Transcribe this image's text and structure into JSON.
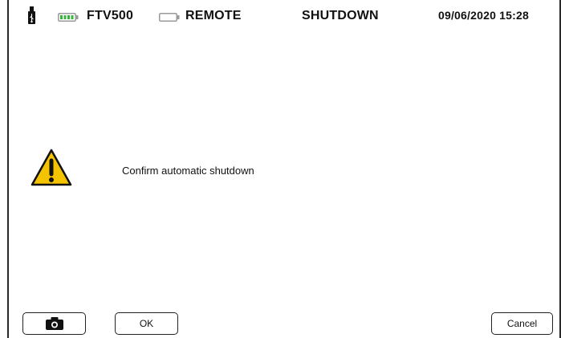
{
  "status_bar": {
    "usb_icon": "usb-icon",
    "battery_icon": "battery-icon",
    "device_name": "FTV500",
    "remote_battery_icon": "remote-battery-icon",
    "remote_label": "REMOTE",
    "mode_label": "SHUTDOWN",
    "datetime": "09/06/2020 15:28",
    "battery_color": "#37b43c"
  },
  "dialog": {
    "icon": "warning-icon",
    "icon_color": "#f5c400",
    "message": "Confirm automatic shutdown"
  },
  "buttons": {
    "camera_icon": "camera-icon",
    "ok_label": "OK",
    "cancel_label": "Cancel"
  }
}
